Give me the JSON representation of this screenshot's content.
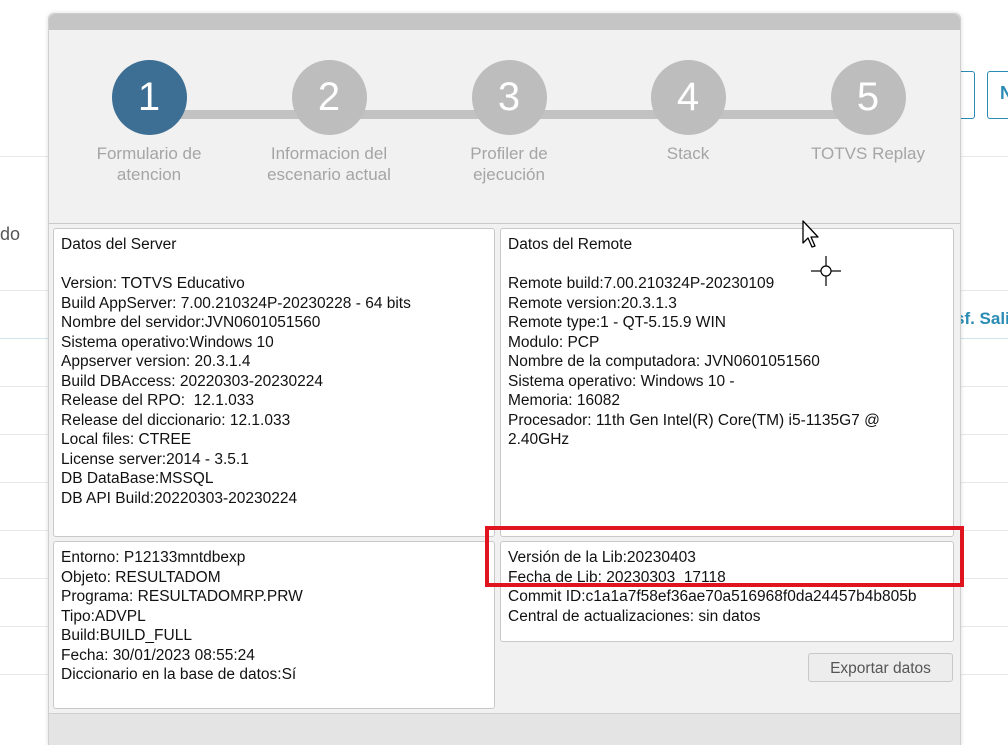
{
  "background": {
    "left_text": "do",
    "right_button_letter": "N",
    "right_link": "sf. Sali"
  },
  "stepper": {
    "steps": [
      {
        "number": "1",
        "label_line1": "Formulario de",
        "label_line2": "atencion"
      },
      {
        "number": "2",
        "label_line1": "Informacion del",
        "label_line2": "escenario actual"
      },
      {
        "number": "3",
        "label_line1": "Profiler de",
        "label_line2": "ejecución"
      },
      {
        "number": "4",
        "label_line1": "Stack",
        "label_line2": ""
      },
      {
        "number": "5",
        "label_line1": "TOTVS Replay",
        "label_line2": ""
      }
    ]
  },
  "server": {
    "title": "Datos del Server",
    "lines": [
      "Version: TOTVS Educativo",
      "Build AppServer: 7.00.210324P-20230228 - 64 bits",
      "Nombre del servidor:JVN0601051560",
      "Sistema operativo:Windows 10",
      "Appserver version: 20.3.1.4",
      "Build DBAccess: 20220303-20230224",
      "Release del RPO:  12.1.033",
      "Release del diccionario: 12.1.033",
      "Local files: CTREE",
      "License server:2014 - 3.5.1",
      "DB DataBase:MSSQL",
      "DB API Build:20220303-20230224"
    ]
  },
  "remote": {
    "title": "Datos del Remote",
    "lines": [
      "Remote build:7.00.210324P-20230109",
      "Remote version:20.3.1.3",
      "Remote type:1 - QT-5.15.9 WIN",
      "Modulo: PCP",
      "Nombre de la computadora: JVN0601051560",
      "Sistema operativo: Windows 10 -",
      "Memoria: 16082",
      "Procesador: 11th Gen Intel(R) Core(TM) i5-1135G7 @ 2.40GHz"
    ]
  },
  "environment": {
    "lines": [
      "Entorno: P12133mntdbexp",
      "Objeto: RESULTADOM",
      "Programa: RESULTADOMRP.PRW",
      "Tipo:ADVPL",
      "Build:BUILD_FULL",
      "Fecha: 30/01/2023 08:55:24",
      "Diccionario en la base de datos:Sí"
    ]
  },
  "lib": {
    "lines": [
      "Versión de la Lib:20230403",
      "Fecha de Lib: 20230303_17118",
      "Commit ID:c1a1a7f58ef36ae70a516968f0da24457b4b805b",
      "Central de actualizaciones: sin datos"
    ]
  },
  "export_button": "Exportar datos",
  "colors": {
    "step_active": "#3d6e94",
    "step_inactive": "#bdbdbd",
    "highlight": "#e0141e",
    "accent": "#2a8bb5"
  }
}
